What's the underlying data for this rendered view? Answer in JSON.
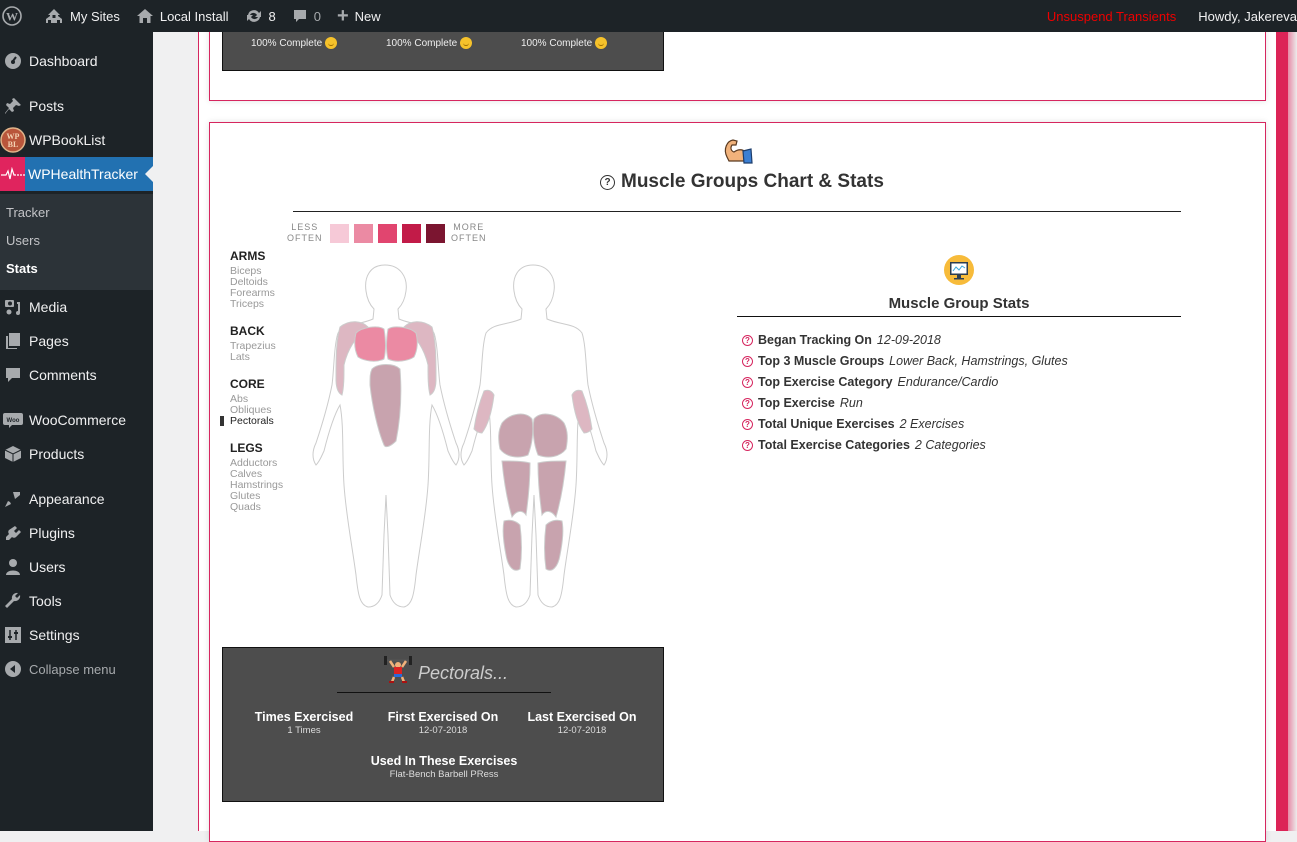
{
  "adminbar": {
    "wp_logo": "wordpress-icon",
    "my_sites": "My Sites",
    "site_name": "Local Install",
    "updates_count": "8",
    "comments_count": "0",
    "new_label": "New",
    "unsuspend": "Unsuspend Transients",
    "howdy": "Howdy, Jakereva"
  },
  "sidebar": {
    "items": [
      {
        "label": "Dashboard",
        "icon": "dashboard-icon"
      },
      {
        "label": "Posts",
        "icon": "pin-icon"
      },
      {
        "label": "WPBookList",
        "icon": "wpbooklist-icon"
      },
      {
        "label": "WPHealthTracker",
        "icon": "heartbeat-icon"
      },
      {
        "label": "Media",
        "icon": "media-icon"
      },
      {
        "label": "Pages",
        "icon": "pages-icon"
      },
      {
        "label": "Comments",
        "icon": "comment-icon"
      },
      {
        "label": "WooCommerce",
        "icon": "woo-icon"
      },
      {
        "label": "Products",
        "icon": "box-icon"
      },
      {
        "label": "Appearance",
        "icon": "brush-icon"
      },
      {
        "label": "Plugins",
        "icon": "plug-icon"
      },
      {
        "label": "Users",
        "icon": "user-icon"
      },
      {
        "label": "Tools",
        "icon": "wrench-icon"
      },
      {
        "label": "Settings",
        "icon": "sliders-icon"
      },
      {
        "label": "Collapse menu",
        "icon": "collapse-icon"
      }
    ],
    "submenu": [
      "Tracker",
      "Users",
      "Stats"
    ],
    "active_sub": "Stats"
  },
  "top_card": {
    "progress": [
      {
        "label": "100% Complete",
        "percent": 100
      },
      {
        "label": "100% Complete",
        "percent": 100
      },
      {
        "label": "100% Complete",
        "percent": 100
      }
    ]
  },
  "main": {
    "title": "Muscle Groups Chart & Stats",
    "help": "?",
    "legend": {
      "less": "LESS OFTEN",
      "less_1": "LESS",
      "less_2": "OFTEN",
      "more_1": "MORE",
      "more_2": "OFTEN",
      "colors": [
        "#f6c9d7",
        "#eb8aa3",
        "#e1456f",
        "#c21b48",
        "#7b1530"
      ]
    },
    "groups": [
      {
        "name": "ARMS",
        "muscles": [
          "Biceps",
          "Deltoids",
          "Forearms",
          "Triceps"
        ]
      },
      {
        "name": "BACK",
        "muscles": [
          "Trapezius",
          "Lats"
        ]
      },
      {
        "name": "CORE",
        "muscles": [
          "Abs",
          "Obliques",
          "Pectorals"
        ]
      },
      {
        "name": "LEGS",
        "muscles": [
          "Adductors",
          "Calves",
          "Hamstrings",
          "Glutes",
          "Quads"
        ]
      }
    ],
    "selected_muscle": "Pectorals",
    "body_colors": {
      "pectorals": "#eb8aa3",
      "deltoids": "#ddb7c2",
      "abs": "#c8a3ae",
      "forearms": "#ddb7c2",
      "glutes": "#c8a3ae",
      "hamstrings": "#c8a3ae",
      "calves": "#c8a3ae",
      "outline": "#cccccc"
    }
  },
  "stats": {
    "title": "Muscle Group Stats",
    "rows": [
      {
        "label": "Began Tracking On",
        "value": "12-09-2018"
      },
      {
        "label": "Top 3 Muscle Groups",
        "value": "Lower Back, Hamstrings, Glutes"
      },
      {
        "label": "Top Exercise Category",
        "value": "Endurance/Cardio"
      },
      {
        "label": "Top Exercise",
        "value": "Run"
      },
      {
        "label": "Total Unique Exercises",
        "value": "2 Exercises"
      },
      {
        "label": "Total Exercise Categories",
        "value": "2 Categories"
      }
    ]
  },
  "detail": {
    "title": "Pectorals...",
    "times_label": "Times Exercised",
    "times_value": "1 Times",
    "first_label": "First Exercised On",
    "first_value": "12-07-2018",
    "last_label": "Last Exercised On",
    "last_value": "12-07-2018",
    "used_label": "Used In These Exercises",
    "used_value": "Flat-Bench Barbell PRess"
  }
}
